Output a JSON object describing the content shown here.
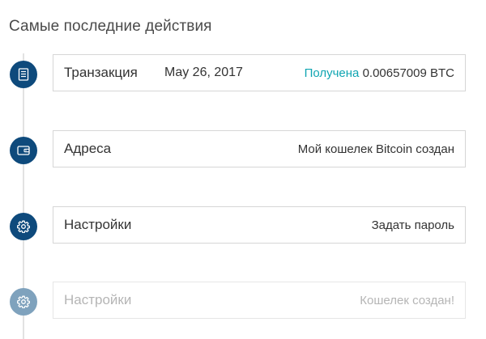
{
  "section": {
    "title": "Самые последние действия"
  },
  "colors": {
    "marker_active": "#0e4a7c",
    "marker_faded": "#7fa2bd",
    "received_accent": "#10a5b2"
  },
  "activities": [
    {
      "icon": "document-icon",
      "label": "Транзакция",
      "date": "May 26, 2017",
      "status": "Получена",
      "amount": "0.00657009 BTC"
    },
    {
      "icon": "wallet-icon",
      "label": "Адреса",
      "detail": "Мой кошелек Bitcoin создан"
    },
    {
      "icon": "gear-icon",
      "label": "Настройки",
      "detail": "Задать пароль"
    },
    {
      "icon": "gear-icon",
      "label": "Настройки",
      "detail": "Кошелек создан!",
      "faded": true
    }
  ]
}
